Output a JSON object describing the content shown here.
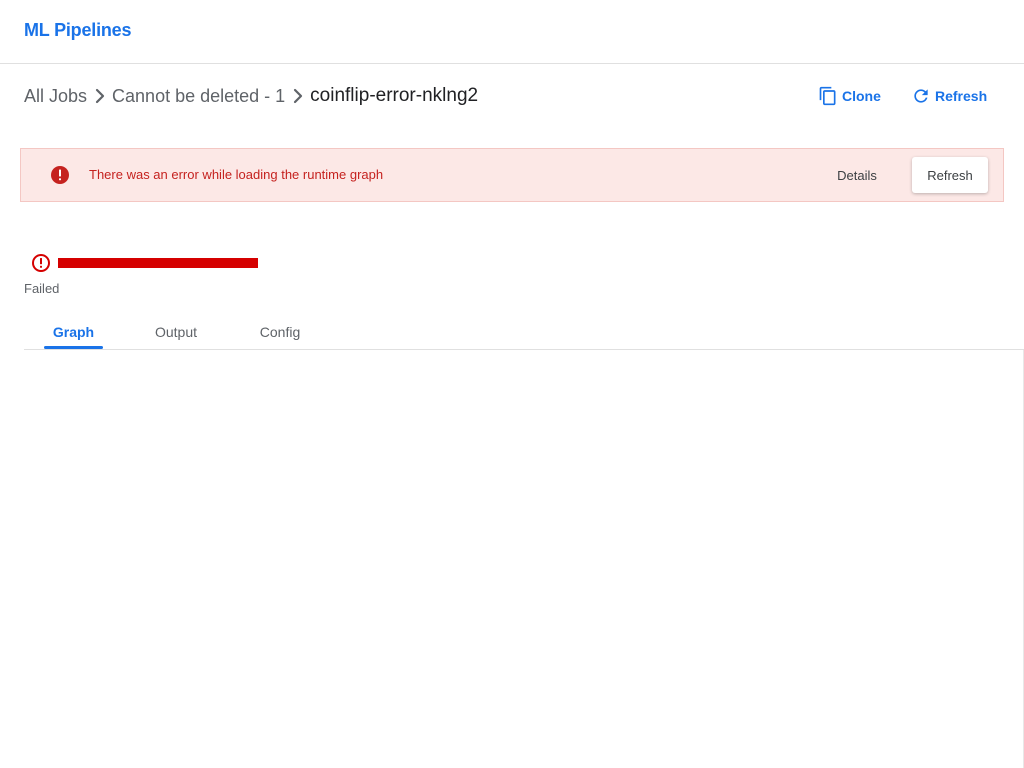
{
  "header": {
    "title": "ML Pipelines"
  },
  "breadcrumb": {
    "items": [
      {
        "label": "All Jobs"
      },
      {
        "label": "Cannot be deleted - 1"
      },
      {
        "label": "coinflip-error-nklng2"
      }
    ]
  },
  "toolbar": {
    "clone_label": "Clone",
    "refresh_label": "Refresh"
  },
  "error_banner": {
    "message": "There was an error while loading the runtime graph",
    "details_label": "Details",
    "refresh_label": "Refresh",
    "color": "#c5221f",
    "background": "#fce8e6"
  },
  "run_status": {
    "label": "Failed",
    "color": "#d50000"
  },
  "tabs": [
    {
      "label": "Graph",
      "active": true
    },
    {
      "label": "Output",
      "active": false
    },
    {
      "label": "Config",
      "active": false
    }
  ],
  "icons": {
    "crumb_separator": "chevron-right-icon",
    "clone": "copy-icon",
    "refresh": "refresh-icon",
    "banner_error": "error-filled-icon",
    "status": "error-outline-icon"
  },
  "colors": {
    "accent": "#1a73e8",
    "error": "#d50000"
  }
}
